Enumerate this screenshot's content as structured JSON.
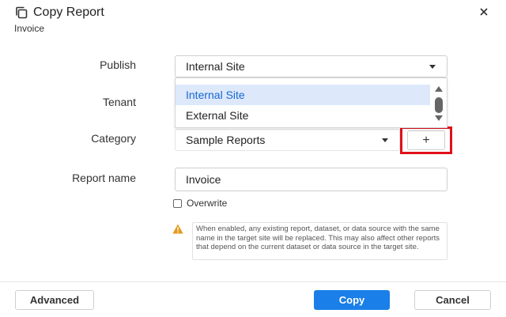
{
  "dialog": {
    "title": "Copy Report",
    "subtitle": "Invoice",
    "close_glyph": "✕"
  },
  "form": {
    "publish": {
      "label": "Publish",
      "value": "Internal Site",
      "options": [
        "Internal Site",
        "External Site"
      ],
      "highlighted_option": "Internal Site"
    },
    "tenant": {
      "label": "Tenant"
    },
    "category": {
      "label": "Category",
      "value": "Sample Reports",
      "add_button_label": "+"
    },
    "report_name": {
      "label": "Report name",
      "value": "Invoice"
    },
    "overwrite": {
      "label": "Overwrite",
      "checked": false
    },
    "warning": {
      "text": "When enabled, any existing report, dataset, or data source with the same name in the target site will be replaced. This may also affect other reports that depend on the current dataset or data source in the target site."
    }
  },
  "footer": {
    "advanced_label": "Advanced",
    "copy_label": "Copy",
    "cancel_label": "Cancel"
  },
  "colors": {
    "primary": "#1a7fe8",
    "highlight_border": "#e0101a",
    "selected_option_bg": "#dde9fb",
    "selected_option_text": "#1a66d2",
    "warning_icon": "#e3971b"
  },
  "icons": {
    "title": "copy-icon",
    "close": "close-icon",
    "warning": "warning-triangle-icon"
  }
}
